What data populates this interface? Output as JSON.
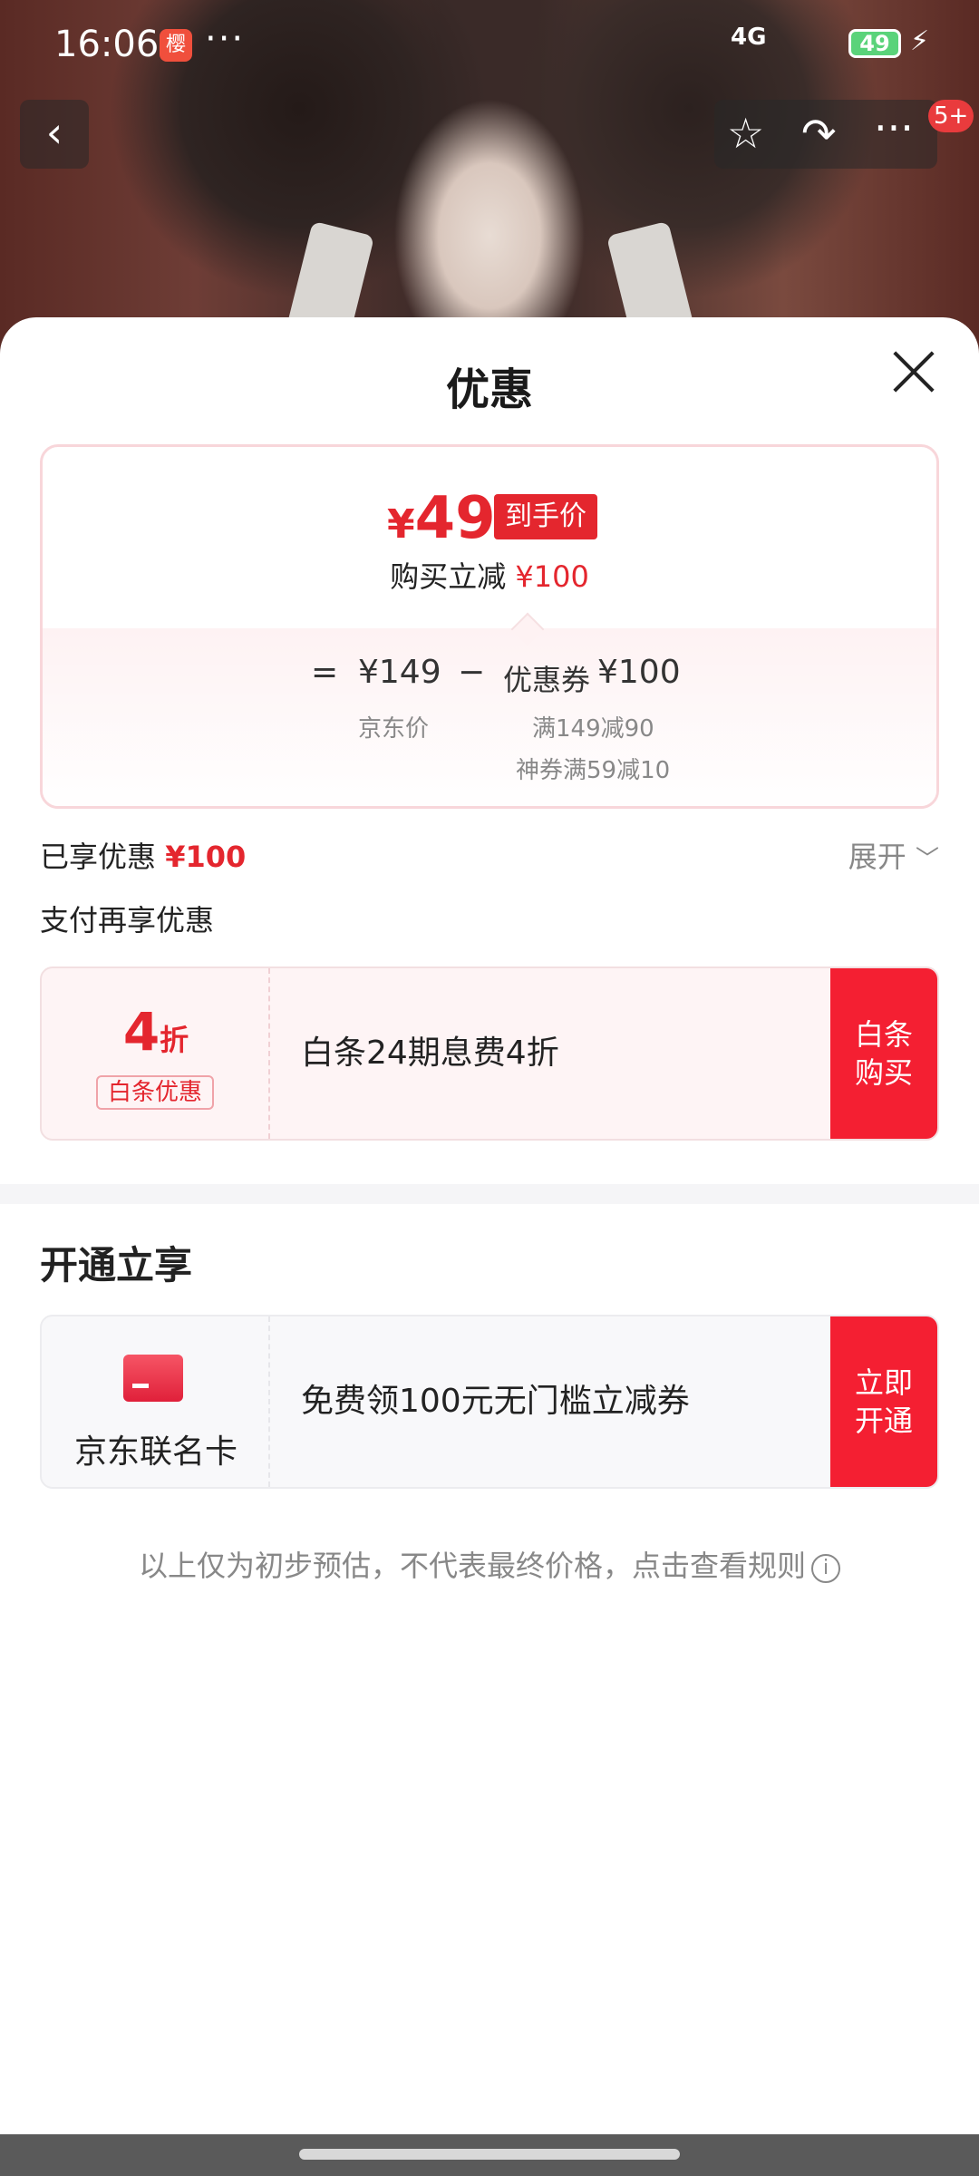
{
  "status_bar": {
    "time": "16:06",
    "app_badge": "樱",
    "dots": "···",
    "network": "4G",
    "battery": "49"
  },
  "header": {
    "back_icon": "‹",
    "star_icon": "☆",
    "share_icon": "↷",
    "more_icon": "···",
    "notification_badge": "5+"
  },
  "sheet": {
    "title": "优惠",
    "price_box": {
      "currency": "¥",
      "final_price": "49",
      "final_tag": "到手价",
      "reduce_label": "购买立减",
      "reduce_value": "¥100",
      "equals": "=",
      "jd_price": "¥149",
      "minus": "−",
      "coupon_label": "优惠券",
      "coupon_value": "¥100",
      "jd_price_label": "京东价",
      "coupon_detail_1": "满149减90",
      "coupon_detail_2": "神券满59减10"
    },
    "enjoyed_label": "已享优惠",
    "enjoyed_value": "¥100",
    "expand_label": "展开",
    "pay_more_label": "支付再享优惠",
    "baitiao": {
      "discount_num": "4",
      "discount_unit": "折",
      "tag": "白条优惠",
      "description": "白条24期息费4折",
      "button": "白条\n购买"
    },
    "open_section_title": "开通立享",
    "card": {
      "label": "京东联名卡",
      "description": "免费领100元无门槛立减券",
      "button": "立即\n开通"
    },
    "note": "以上仅为初步预估，不代表最终价格，点击查看规则",
    "info_icon": "i"
  },
  "colors": {
    "accent": "#e4262e",
    "button": "#f41f32"
  }
}
